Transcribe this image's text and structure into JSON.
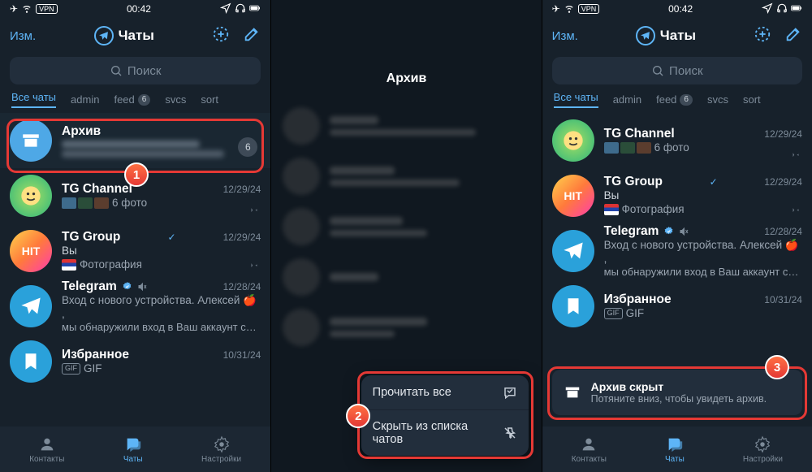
{
  "status": {
    "time": "00:42"
  },
  "header": {
    "edit": "Изм.",
    "title": "Чаты"
  },
  "search": {
    "placeholder": "Поиск"
  },
  "tabs": {
    "all": "Все чаты",
    "admin": "admin",
    "feed": "feed",
    "feed_badge": "6",
    "svcs": "svcs",
    "sort": "sort"
  },
  "panel1": {
    "archive": {
      "title": "Архив",
      "badge": "6"
    },
    "tgch": {
      "title": "TG Channel",
      "msg": "6 фото",
      "time": "12/29/24"
    },
    "tgg": {
      "title": "TG Group",
      "you": "Вы",
      "msg": "Фотография",
      "time": "12/29/24"
    },
    "tgoff": {
      "title": "Telegram",
      "time": "12/28/24",
      "msg1": "Вход с нового устройства. Алексей 🍎 ,",
      "msg2": "мы обнаружили вход в Ваш аккаунт с…"
    },
    "fav": {
      "title": "Избранное",
      "msg": "GIF",
      "time": "10/31/24"
    }
  },
  "panel2": {
    "title": "Архив",
    "menu_read": "Прочитать все",
    "menu_hide": "Скрыть из списка чатов"
  },
  "panel3": {
    "tgch": {
      "title": "TG Channel",
      "msg": "6 фото",
      "time": "12/29/24"
    },
    "tgg": {
      "title": "TG Group",
      "you": "Вы",
      "msg": "Фотография",
      "time": "12/29/24"
    },
    "tgoff": {
      "title": "Telegram",
      "time": "12/28/24",
      "msg1": "Вход с нового устройства. Алексей 🍎 ,",
      "msg2": "мы обнаружили вход в Ваш аккаунт с…"
    },
    "fav": {
      "title": "Избранное",
      "msg": "GIF",
      "time": "10/31/24"
    },
    "toast_title": "Архив скрыт",
    "toast_sub": "Потяните вниз, чтобы увидеть архив."
  },
  "bottom": {
    "contacts": "Контакты",
    "chats": "Чаты",
    "settings": "Настройки"
  },
  "steps": {
    "s1": "1",
    "s2": "2",
    "s3": "3"
  }
}
